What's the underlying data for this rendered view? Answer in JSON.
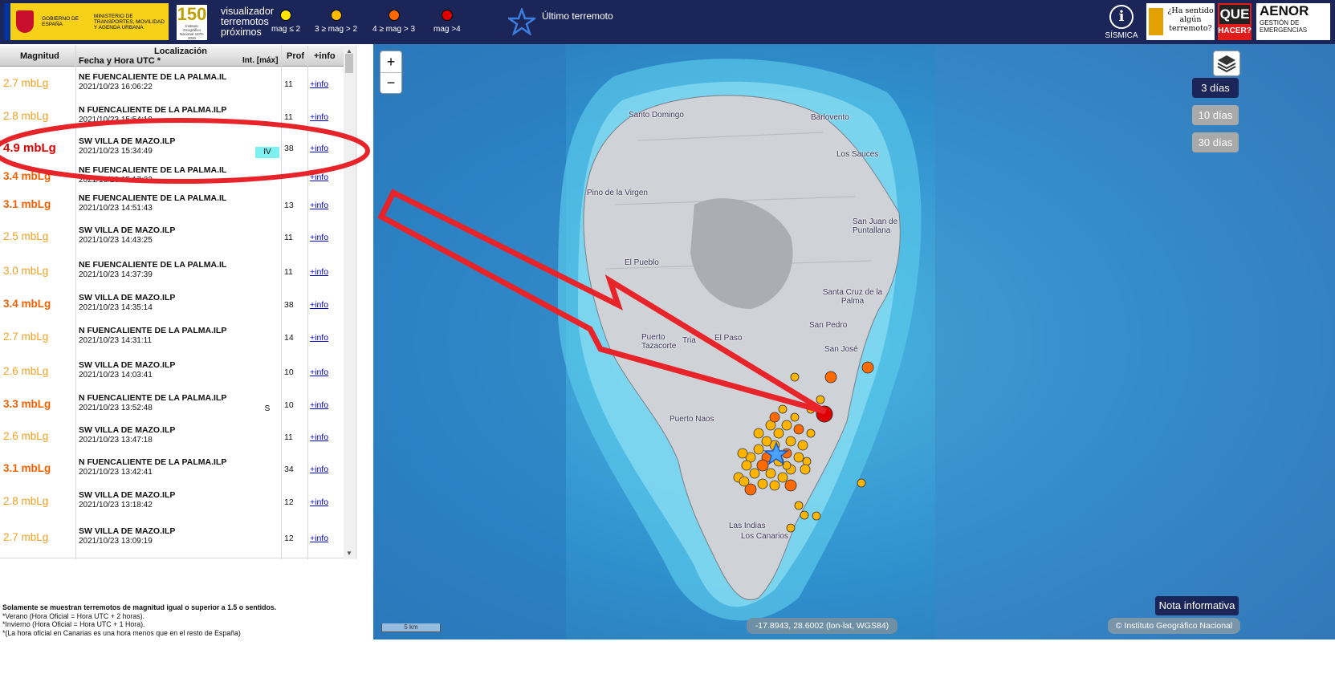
{
  "header": {
    "gov_text": "GOBIERNO DE ESPAÑA",
    "ministry_text": "MINISTERIO DE TRANSPORTES, MOVILIDAD Y AGENDA URBANA",
    "ign_number": "150",
    "ign_caption": "Instituto Geográfico Nacional 1870-2020",
    "viz_title": "visualizador terremotos próximos",
    "legend": [
      {
        "label": "mag ≤ 2",
        "color": "#ffe600"
      },
      {
        "label": "3 ≥ mag > 2",
        "color": "#ffbb00"
      },
      {
        "label": "4 ≥ mag > 3",
        "color": "#ff6a00"
      },
      {
        "label": "mag >4",
        "color": "#e00000"
      }
    ],
    "last_quake_label": "Último terremoto",
    "sismica_label": "SÍSMICA",
    "felt_label": "¿Ha sentido algún terremoto?",
    "que_label": "QUE",
    "hacer_label": "HACER?",
    "aenor_label": "AENOR",
    "aenor_sub": "GESTIÓN DE EMERGENCIAS"
  },
  "table": {
    "headers": {
      "magnitude": "Magnitud",
      "datetime": "Fecha y Hora UTC *",
      "location": "Localización",
      "intensity": "Int. [máx]",
      "depth": "Prof",
      "info": "+info"
    },
    "rows": [
      {
        "mag": "2.7 mbLg",
        "color": "#f0a020",
        "bold": false,
        "loc": "NE FUENCALIENTE DE LA PALMA.IL",
        "dt": "2021/10/23 16:06:22",
        "int": "",
        "prof": "11",
        "info": "+info"
      },
      {
        "mag": "2.8 mbLg",
        "color": "#f0a020",
        "bold": false,
        "loc": "N FUENCALIENTE DE LA PALMA.ILP",
        "dt": "2021/10/23 15:54:10",
        "int": "",
        "prof": "11",
        "info": "+info"
      },
      {
        "mag": "4.9 mbLg",
        "color": "#e00000",
        "bold": true,
        "loc": "SW VILLA DE MAZO.ILP",
        "dt": "2021/10/23 15:34:49",
        "int": "IV",
        "prof": "38",
        "info": "+info"
      },
      {
        "mag": "3.4 mbLg",
        "color": "#f06000",
        "bold": true,
        "loc": "NE FUENCALIENTE DE LA PALMA.IL",
        "dt": "2021/10/23 15:17:32",
        "int": "",
        "prof": "",
        "info": "+info"
      },
      {
        "mag": "3.1 mbLg",
        "color": "#f06000",
        "bold": true,
        "loc": "NE FUENCALIENTE DE LA PALMA.IL",
        "dt": "2021/10/23 14:51:43",
        "int": "",
        "prof": "13",
        "info": "+info"
      },
      {
        "mag": "2.5 mbLg",
        "color": "#f0a020",
        "bold": false,
        "loc": "SW VILLA DE MAZO.ILP",
        "dt": "2021/10/23 14:43:25",
        "int": "",
        "prof": "11",
        "info": "+info"
      },
      {
        "mag": "3.0 mbLg",
        "color": "#f0a020",
        "bold": false,
        "loc": "NE FUENCALIENTE DE LA PALMA.IL",
        "dt": "2021/10/23 14:37:39",
        "int": "",
        "prof": "11",
        "info": "+info"
      },
      {
        "mag": "3.4 mbLg",
        "color": "#f06000",
        "bold": true,
        "loc": "SW VILLA DE MAZO.ILP",
        "dt": "2021/10/23 14:35:14",
        "int": "",
        "prof": "38",
        "info": "+info"
      },
      {
        "mag": "2.7 mbLg",
        "color": "#f0a020",
        "bold": false,
        "loc": "N FUENCALIENTE DE LA PALMA.ILP",
        "dt": "2021/10/23 14:31:11",
        "int": "",
        "prof": "14",
        "info": "+info"
      },
      {
        "mag": "2.6 mbLg",
        "color": "#f0a020",
        "bold": false,
        "loc": "SW VILLA DE MAZO.ILP",
        "dt": "2021/10/23 14:03:41",
        "int": "",
        "prof": "10",
        "info": "+info"
      },
      {
        "mag": "3.3 mbLg",
        "color": "#f06000",
        "bold": true,
        "loc": "N FUENCALIENTE DE LA PALMA.ILP",
        "dt": "2021/10/23 13:52:48",
        "int": "S",
        "prof": "10",
        "info": "+info"
      },
      {
        "mag": "2.6 mbLg",
        "color": "#f0a020",
        "bold": false,
        "loc": "SW VILLA DE MAZO.ILP",
        "dt": "2021/10/23 13:47:18",
        "int": "",
        "prof": "11",
        "info": "+info"
      },
      {
        "mag": "3.1 mbLg",
        "color": "#f06000",
        "bold": true,
        "loc": "N FUENCALIENTE DE LA PALMA.ILP",
        "dt": "2021/10/23 13:42:41",
        "int": "",
        "prof": "34",
        "info": "+info"
      },
      {
        "mag": "2.8 mbLg",
        "color": "#f0a020",
        "bold": false,
        "loc": "SW VILLA DE MAZO.ILP",
        "dt": "2021/10/23 13:18:42",
        "int": "",
        "prof": "12",
        "info": "+info"
      },
      {
        "mag": "2.7 mbLg",
        "color": "#f0a020",
        "bold": false,
        "loc": "SW VILLA DE MAZO.ILP",
        "dt": "2021/10/23 13:09:19",
        "int": "",
        "prof": "12",
        "info": "+info"
      }
    ]
  },
  "notes": {
    "line1": "Solamente se muestran terremotos de magnitud igual o superior a 1.5 o sentidos.",
    "line2": "*Verano (Hora Oficial = Hora UTC + 2 horas).",
    "line3": "*Invierno (Hora Oficial = Hora UTC + 1 Hora).",
    "line4": "*(La hora oficial en Canarias es una hora menos que en el resto de España)"
  },
  "map": {
    "zoom_in": "+",
    "zoom_out": "−",
    "day_buttons": [
      "3 días",
      "10 días",
      "30 días"
    ],
    "active_days": "3 días",
    "towns": [
      "Santo Domingo",
      "Barlovento",
      "Los Sauces",
      "Pino de la Virgen",
      "San Juan de Puntallana",
      "El Pueblo",
      "Santa Cruz de la Palma",
      "San Pedro",
      "Puerto Tazacorte",
      "Tria",
      "El Paso",
      "San José",
      "Puerto Naos",
      "Las Indias",
      "Los Canarios"
    ],
    "scale_label": "5 km",
    "coords": "-17.8943, 28.6002 (lon-lat, WGS84)",
    "attribution": "© Instituto Geográfico Nacional",
    "nota": "Nota informativa"
  }
}
